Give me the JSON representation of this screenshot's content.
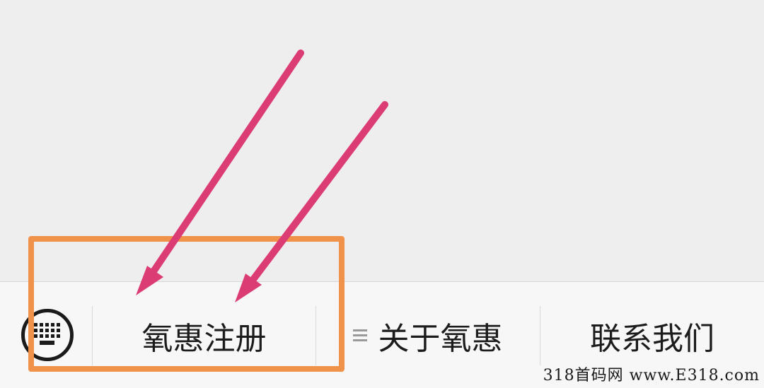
{
  "menu": {
    "items": [
      {
        "label": "氧惠注册"
      },
      {
        "label": "关于氧惠"
      },
      {
        "label": "联系我们"
      }
    ]
  },
  "annotation": {
    "box_color": "#f0924a",
    "arrow_color": "#dc3c74"
  },
  "watermark": {
    "text": "318首码网 www.E318.com"
  },
  "icons": {
    "keyboard": "keyboard-icon",
    "submenu": "menu-lines-icon"
  }
}
